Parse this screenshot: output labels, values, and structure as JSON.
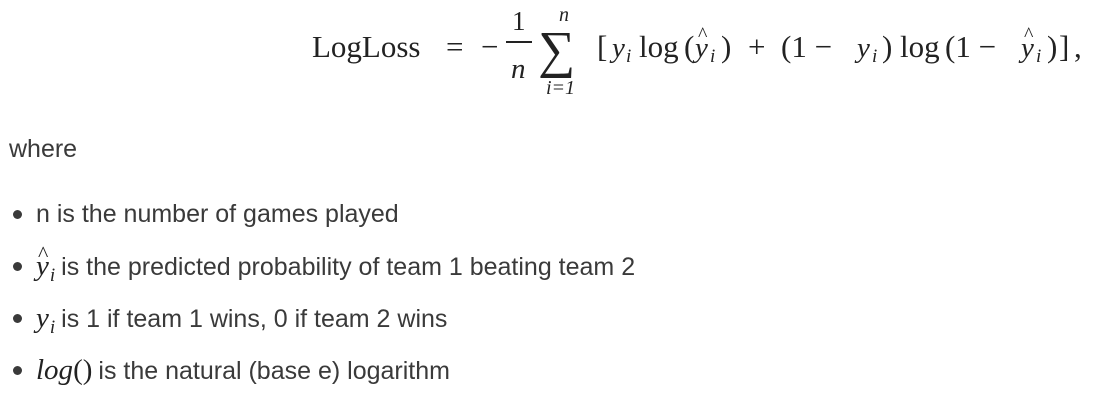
{
  "formula": {
    "lhs": "LogLoss",
    "equals": "=",
    "minus": "−",
    "frac_num": "1",
    "frac_den": "n",
    "sum_symbol": "∑",
    "sum_upper": "n",
    "sum_lower": "i=1",
    "body": {
      "open_bracket": "[",
      "y": "y",
      "sub_i": "i",
      "log": "log",
      "lparen": "(",
      "rparen": ")",
      "plus": "+",
      "one_minus": "(1 −",
      "one_minus_2": "(1 −",
      "close_paren": ")",
      "close_bracket": "]",
      "comma": ","
    }
  },
  "where_label": "where",
  "bullets": [
    {
      "math": "",
      "text": "n is the number of games played"
    },
    {
      "math_base": "y",
      "math_sub": "i",
      "hat": "^",
      "text": "is the predicted probability of team 1 beating team 2"
    },
    {
      "math_base": "y",
      "math_sub": "i",
      "text": "is 1 if team 1 wins, 0 if team 2 wins"
    },
    {
      "math_base": "log",
      "math_paren": "()",
      "text": "is the natural (base e) logarithm"
    }
  ]
}
